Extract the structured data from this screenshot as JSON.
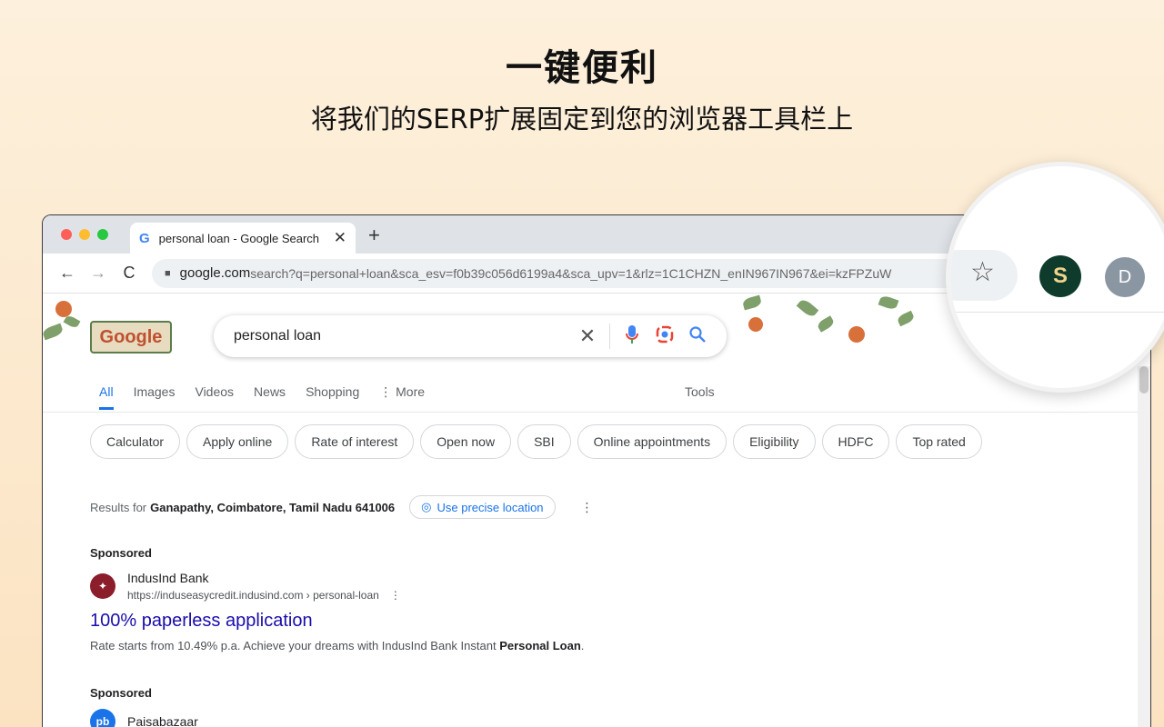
{
  "hero": {
    "title": "一键便利",
    "subtitle": "将我们的SERP扩展固定到您的浏览器工具栏上"
  },
  "browser": {
    "tab_title": "personal loan - Google Search",
    "tab_close": "✕",
    "new_tab": "+",
    "nav": {
      "back": "←",
      "forward": "→",
      "reload": "C"
    },
    "url_host": "google.com",
    "url_path": "search?q=personal+loan&sca_esv=f0b39c056d6199a4&sca_upv=1&rlz=1C1CHZN_enIN967IN967&ei=kzFPZuW"
  },
  "google": {
    "logo": "Google",
    "query": "personal loan",
    "tabs": [
      "All",
      "Images",
      "Videos",
      "News",
      "Shopping",
      "⋮ More"
    ],
    "tools": "Tools",
    "chips": [
      "Calculator",
      "Apply online",
      "Rate of interest",
      "Open now",
      "SBI",
      "Online appointments",
      "Eligibility",
      "HDFC",
      "Top rated"
    ],
    "location_prefix": "Results for",
    "location": "Ganapathy, Coimbatore, Tamil Nadu 641006",
    "precise_location": "Use precise location",
    "results": [
      {
        "label": "Sponsored",
        "site": "IndusInd Bank",
        "url": "https://induseasycredit.indusind.com › personal-loan",
        "title": "100% paperless application",
        "desc_pre": "Rate starts from 10.49% p.a. Achieve your dreams with IndusInd Bank Instant ",
        "desc_bold": "Personal Loan",
        "desc_post": "."
      },
      {
        "label": "Sponsored",
        "site": "Paisabazaar",
        "favicon_text": "pb"
      }
    ]
  },
  "magnifier": {
    "extension_letter": "S",
    "avatar": "D"
  },
  "colors": {
    "link": "#1a0dab",
    "accent": "#1a73e8",
    "extension_bg": "#0f3b2c"
  }
}
